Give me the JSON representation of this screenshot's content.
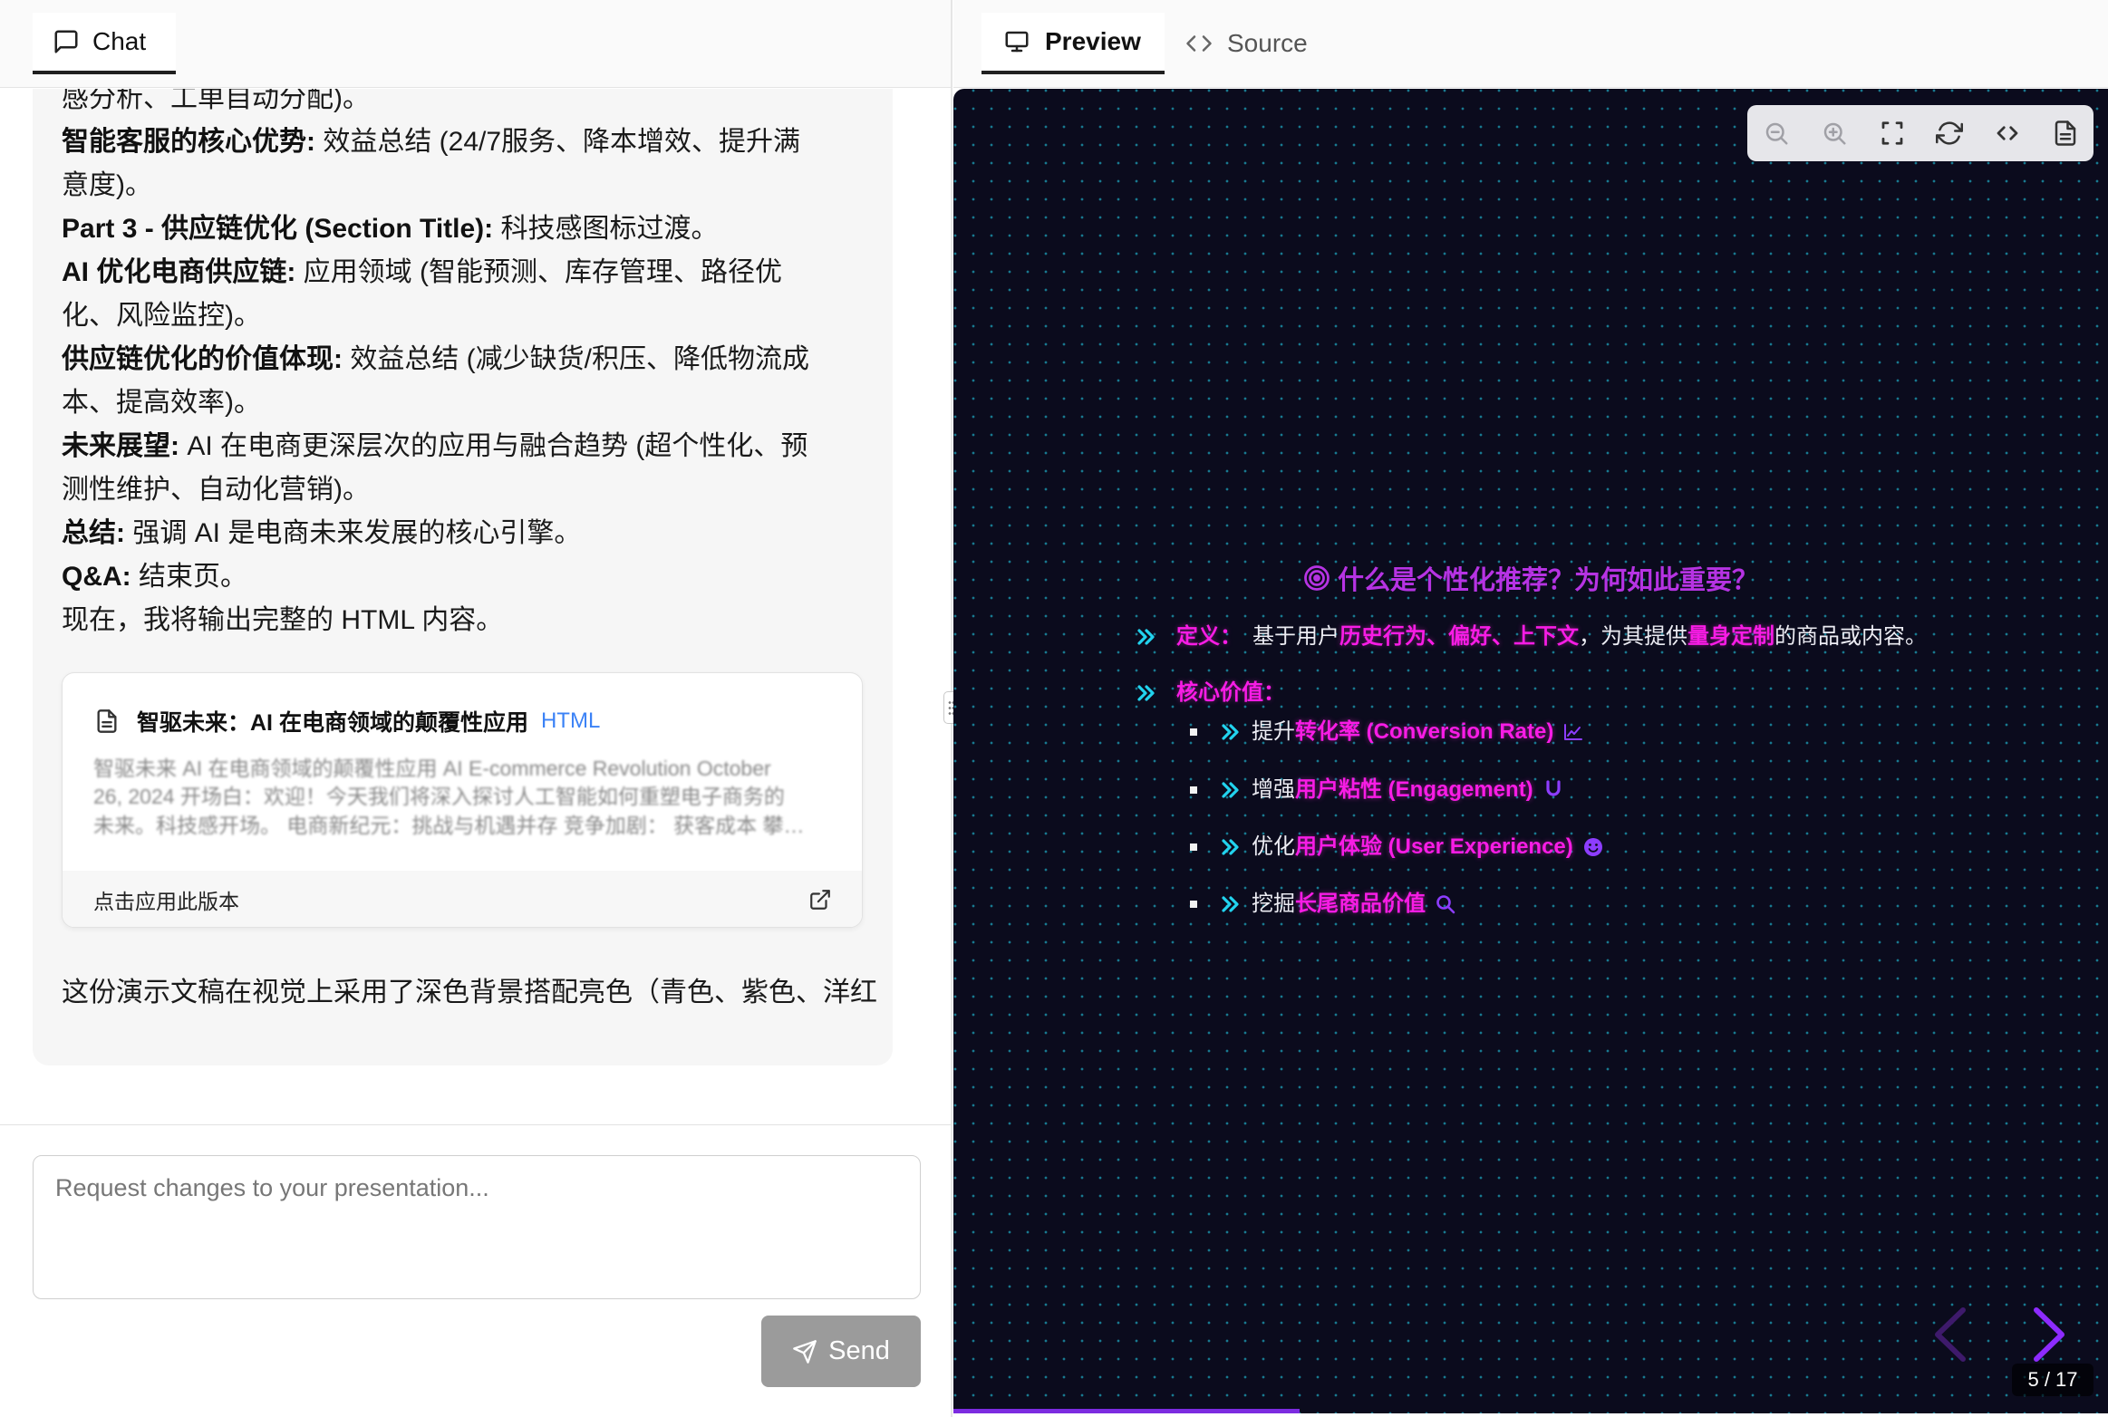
{
  "chat": {
    "tab_label": "Chat",
    "message_lines": [
      {
        "text": "感分析、工单自动分配)。"
      },
      {
        "bold": "智能客服的核心优势:",
        "text": " 效益总结 (24/7服务、降本增效、提升满"
      },
      {
        "text": "意度)。"
      },
      {
        "bold": "Part 3 - 供应链优化 (Section Title):",
        "text": " 科技感图标过渡。"
      },
      {
        "bold": "AI 优化电商供应链:",
        "text": " 应用领域 (智能预测、库存管理、路径优"
      },
      {
        "text": "化、风险监控)。"
      },
      {
        "bold": "供应链优化的价值体现:",
        "text": " 效益总结 (减少缺货/积压、降低物流成"
      },
      {
        "text": "本、提高效率)。"
      },
      {
        "bold": "未来展望:",
        "text": " AI 在电商更深层次的应用与融合趋势 (超个性化、预"
      },
      {
        "text": "测性维护、自动化营销)。"
      },
      {
        "bold": "总结:",
        "text": " 强调 AI 是电商未来发展的核心引擎。"
      },
      {
        "bold": "Q&A:",
        "text": " 结束页。"
      },
      {
        "text": "现在，我将输出完整的 HTML 内容。"
      }
    ],
    "artifact": {
      "icon": "file-text-icon",
      "title": "智驱未来：AI 在电商领域的颠覆性应用",
      "badge": "HTML",
      "preview_lines": [
        "智驱未来 AI 在电商领域的颠覆性应用 AI E-commerce Revolution October",
        "26, 2024 开场白：欢迎！今天我们将深入探讨人工智能如何重塑电子商务的",
        "未来。科技感开场。 电商新纪元：挑战与机遇并存 竞争加剧： 获客成本 攀…"
      ],
      "apply_label": "点击应用此版本"
    },
    "trailing_text": "这份演示文稿在视觉上采用了深色背景搭配亮色（青色、紫色、洋红",
    "input": {
      "placeholder": "Request changes to your presentation..."
    },
    "send_label": "Send"
  },
  "preview_panel": {
    "tabs": [
      {
        "label": "Preview",
        "icon": "monitor-icon",
        "active": true
      },
      {
        "label": "Source",
        "icon": "code-icon",
        "active": false
      }
    ],
    "toolbar_icons": [
      "zoom-out-icon",
      "zoom-in-icon",
      "fullscreen-icon",
      "refresh-icon",
      "code-icon",
      "document-icon"
    ],
    "slide": {
      "title_icon": "bullseye-icon",
      "title": "什么是个性化推荐？为何如此重要？",
      "definition": {
        "label": "定义：",
        "parts": [
          {
            "text": "基于用户"
          },
          {
            "highlight": "历史行为、偏好、上下文"
          },
          {
            "text": "，为其提供"
          },
          {
            "highlight": "量身定制"
          },
          {
            "text": "的商品或内容。"
          }
        ]
      },
      "core_value_label": "核心价值：",
      "values": [
        {
          "verb": "提升",
          "highlight": "转化率 (Conversion Rate)",
          "icon": "chart-line-icon"
        },
        {
          "verb": "增强",
          "highlight": "用户粘性 (Engagement)",
          "icon": "magnet-icon"
        },
        {
          "verb": "优化",
          "highlight": "用户体验 (User Experience)",
          "icon": "smile-icon"
        },
        {
          "verb": "挖掘",
          "highlight": "长尾商品价值",
          "icon": "search-icon"
        }
      ]
    },
    "nav": {
      "page_indicator": "5 / 17",
      "progress": 0.3
    }
  },
  "colors": {
    "highlight_magenta": "#f81ce5",
    "accent_cyan": "#22d3ee",
    "title_purple": "#b633e3",
    "icon_violet": "#8d3dff",
    "slide_background": "#0b0b1d",
    "send_button": "#9b9b9b"
  }
}
